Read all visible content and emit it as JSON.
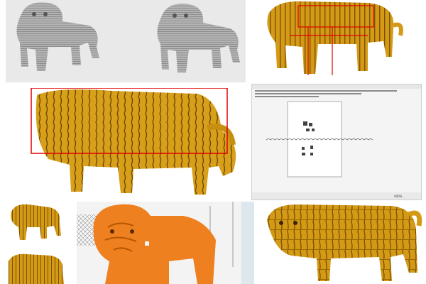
{
  "colors": {
    "render_bg": "#e9e9e9",
    "gray_model": "#a9a9a9",
    "gold_model": "#d49a16",
    "gold_dark": "#7a5200",
    "orange_model": "#ee8020",
    "orange_dark": "#b55500",
    "red_box": "#e00000",
    "cad_bg": "#f4f4f4"
  },
  "panels": [
    {
      "name": "gray-model-previews"
    },
    {
      "name": "gold-slices-top-right"
    },
    {
      "name": "gold-slices-side-closeup"
    },
    {
      "name": "cad-layout-screenshot"
    },
    {
      "name": "small-gold-thumbnails"
    },
    {
      "name": "orange-render-closeup"
    },
    {
      "name": "gold-model-bottom-right"
    }
  ],
  "cad": {
    "zoom_label": "400%"
  }
}
